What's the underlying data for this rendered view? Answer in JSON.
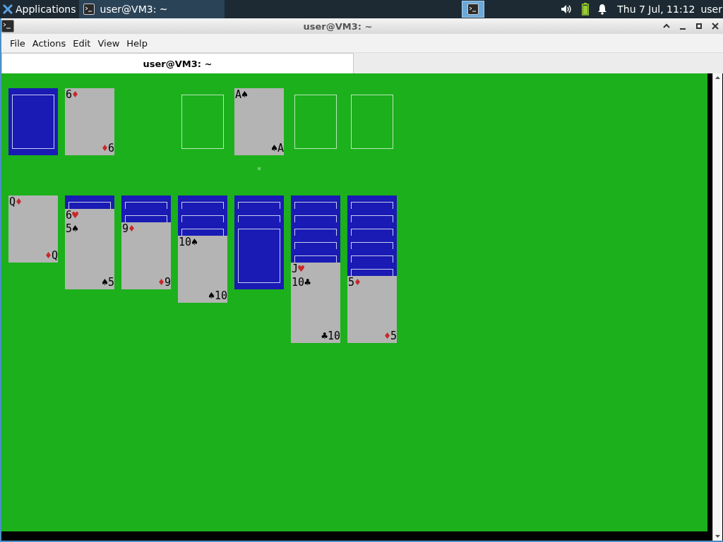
{
  "top_panel": {
    "menu": "Applications",
    "tasks": [
      {
        "title": "user@VM3: ~",
        "selected": true
      }
    ],
    "pager": [
      {
        "selected": true
      }
    ],
    "clock": "Thu  7 Jul, 11:12",
    "user": "user"
  },
  "window": {
    "title": "user@VM3: ~",
    "menu": [
      "File",
      "Actions",
      "Edit",
      "View",
      "Help"
    ],
    "tabs": [
      {
        "label": "user@VM3: ~",
        "selected": true
      }
    ]
  },
  "game": {
    "stock": {
      "face_up": false
    },
    "waste": {
      "face_up": true,
      "top_rank": "6",
      "top_suit": "♦",
      "bottom_suit": "♦",
      "bottom_rank": "6",
      "color": "#c8282a"
    },
    "foundations": [
      {
        "empty": true
      },
      {
        "empty": false,
        "cursor": "*",
        "card": {
          "face_up": true,
          "top_rank": "A",
          "top_suit": "♠",
          "bottom_suit": "♠",
          "bottom_rank": "A",
          "color": "#000000"
        }
      },
      {
        "empty": true
      },
      {
        "empty": true
      }
    ],
    "tableau": [
      {
        "cards": [
          {
            "face_up": true,
            "top_rank": "Q",
            "top_suit": "♦",
            "bottom_suit": "♦",
            "bottom_rank": "Q",
            "color": "#c8282a"
          }
        ]
      },
      {
        "cards": [
          {
            "face_up": false
          },
          {
            "face_up": true,
            "top_rank": "6",
            "top_suit": "♥",
            "color": "#c8282a"
          },
          {
            "face_up": true,
            "top_rank": "5",
            "top_suit": "♠",
            "bottom_suit": "♠",
            "bottom_rank": "5",
            "color": "#000000"
          }
        ]
      },
      {
        "cards": [
          {
            "face_up": false
          },
          {
            "face_up": false
          },
          {
            "face_up": true,
            "top_rank": "9",
            "top_suit": "♦",
            "bottom_suit": "♦",
            "bottom_rank": "9",
            "color": "#c8282a"
          }
        ]
      },
      {
        "cards": [
          {
            "face_up": false
          },
          {
            "face_up": false
          },
          {
            "face_up": false
          },
          {
            "face_up": true,
            "top_rank": "10",
            "top_suit": "♠",
            "bottom_suit": "♠",
            "bottom_rank": "10",
            "color": "#000000"
          }
        ]
      },
      {
        "cards": [
          {
            "face_up": false
          },
          {
            "face_up": false
          },
          {
            "face_up": false
          }
        ]
      },
      {
        "cards": [
          {
            "face_up": false
          },
          {
            "face_up": false
          },
          {
            "face_up": false
          },
          {
            "face_up": false
          },
          {
            "face_up": false
          },
          {
            "face_up": true,
            "top_rank": "J",
            "top_suit": "♥",
            "color": "#c8282a"
          },
          {
            "face_up": true,
            "top_rank": "10",
            "top_suit": "♣",
            "bottom_suit": "♣",
            "bottom_rank": "10",
            "color": "#000000"
          }
        ]
      },
      {
        "cards": [
          {
            "face_up": false
          },
          {
            "face_up": false
          },
          {
            "face_up": false
          },
          {
            "face_up": false
          },
          {
            "face_up": false
          },
          {
            "face_up": false
          },
          {
            "face_up": true,
            "top_rank": "5",
            "top_suit": "♦",
            "bottom_suit": "♦",
            "bottom_rank": "5",
            "color": "#c8282a"
          }
        ]
      }
    ]
  }
}
